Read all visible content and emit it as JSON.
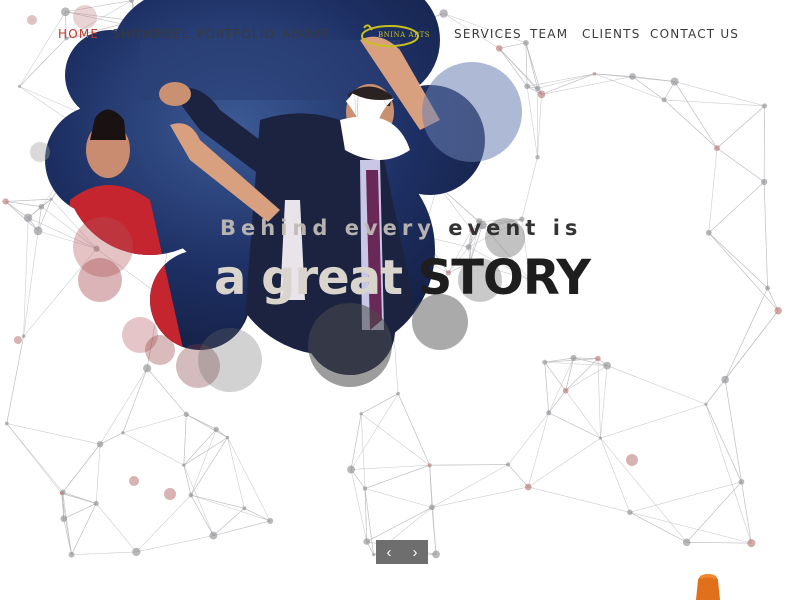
{
  "nav": {
    "home": "HOME",
    "showreel": "SHOWREEL",
    "portfolio": "PORTFOLIO",
    "about": "ABOUT",
    "services": "SERVICES",
    "team": "TEAM",
    "clients": "CLIENTS",
    "contact": "CONTACT US"
  },
  "logo": {
    "text": "BNINA ARTS"
  },
  "hero": {
    "line1_light": "Behind every ",
    "line1_dark": "event is",
    "line2_light": "a great ",
    "line2_dark": "STORY"
  },
  "slider": {
    "prev_icon": "‹",
    "next_icon": "›"
  },
  "colors": {
    "accent": "#c0392b",
    "logo_gold": "#c8c020",
    "stage_blue": "#16254e"
  },
  "icons": [
    "chevron-left-icon",
    "chevron-right-icon",
    "logo-icon"
  ]
}
